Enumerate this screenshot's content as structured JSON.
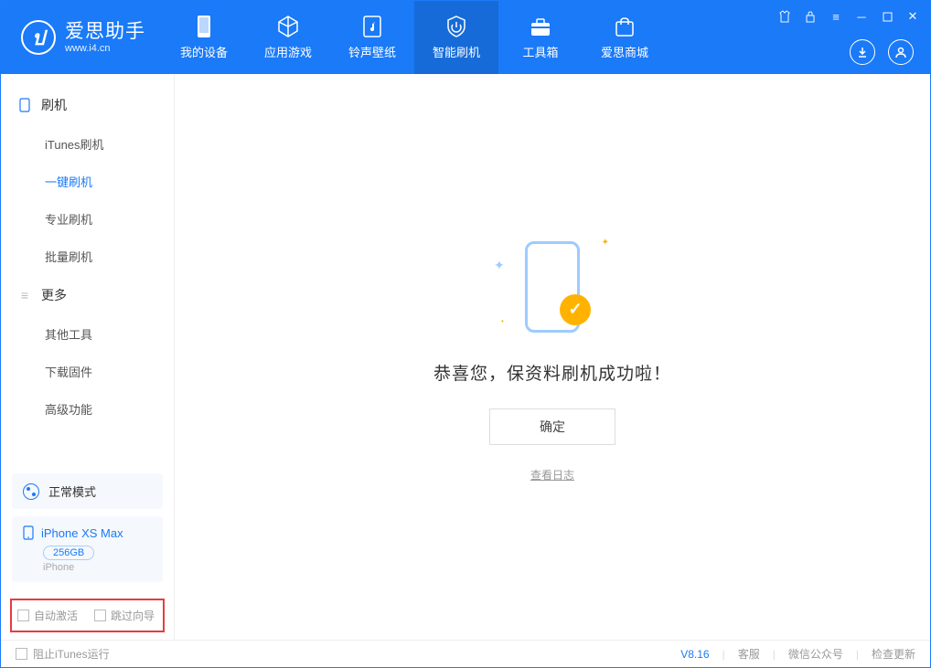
{
  "app": {
    "name": "爱思助手",
    "url": "www.i4.cn"
  },
  "nav": [
    {
      "label": "我的设备"
    },
    {
      "label": "应用游戏"
    },
    {
      "label": "铃声壁纸"
    },
    {
      "label": "智能刷机"
    },
    {
      "label": "工具箱"
    },
    {
      "label": "爱思商城"
    }
  ],
  "sidebar": {
    "section1": {
      "title": "刷机",
      "items": [
        "iTunes刷机",
        "一键刷机",
        "专业刷机",
        "批量刷机"
      ]
    },
    "section2": {
      "title": "更多",
      "items": [
        "其他工具",
        "下载固件",
        "高级功能"
      ]
    }
  },
  "mode": {
    "label": "正常模式"
  },
  "device": {
    "name": "iPhone XS Max",
    "storage": "256GB",
    "type": "iPhone"
  },
  "options": {
    "auto_activate": "自动激活",
    "skip_guide": "跳过向导"
  },
  "main": {
    "success": "恭喜您，保资料刷机成功啦！",
    "ok": "确定",
    "view_log": "查看日志"
  },
  "footer": {
    "block_itunes": "阻止iTunes运行",
    "version": "V8.16",
    "service": "客服",
    "wechat": "微信公众号",
    "update": "检查更新"
  }
}
